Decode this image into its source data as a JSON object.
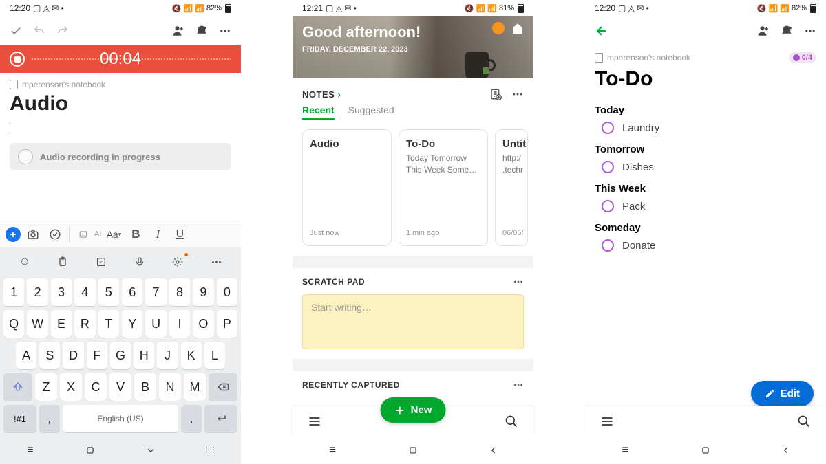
{
  "s1": {
    "status": {
      "time": "12:20",
      "battery": "82%"
    },
    "rec_time": "00:04",
    "notebook": "mperenson's notebook",
    "title": "Audio",
    "audio_msg": "Audio recording in progress",
    "format": {
      "ai": "AI",
      "aa": "Aa",
      "b": "B",
      "i": "I",
      "u": "U"
    },
    "kbd": {
      "r1": [
        "1",
        "2",
        "3",
        "4",
        "5",
        "6",
        "7",
        "8",
        "9",
        "0"
      ],
      "r2": [
        "Q",
        "W",
        "E",
        "R",
        "T",
        "Y",
        "U",
        "I",
        "O",
        "P"
      ],
      "r3": [
        "A",
        "S",
        "D",
        "F",
        "G",
        "H",
        "J",
        "K",
        "L"
      ],
      "r4": [
        "Z",
        "X",
        "C",
        "V",
        "B",
        "N",
        "M"
      ],
      "sym": "!#1",
      "comma": ",",
      "space": "English (US)",
      "dot": "."
    }
  },
  "s2": {
    "status": {
      "time": "12:21",
      "battery": "81%"
    },
    "hero": {
      "title": "Good afternoon!",
      "date": "FRIDAY, DECEMBER 22, 2023"
    },
    "notes_label": "NOTES",
    "tabs": {
      "recent": "Recent",
      "suggested": "Suggested"
    },
    "cards": [
      {
        "title": "Audio",
        "body": "",
        "time": "Just now"
      },
      {
        "title": "To-Do",
        "body": "Today Tomorrow This Week Some…",
        "time": "1 min ago"
      },
      {
        "title": "Untit",
        "body": "http:/\n.techr",
        "time": "06/05/"
      }
    ],
    "scratch_label": "SCRATCH PAD",
    "scratch_ph": "Start writing…",
    "captured_label": "RECENTLY CAPTURED",
    "fab": "New"
  },
  "s3": {
    "status": {
      "time": "12:20",
      "battery": "82%"
    },
    "notebook": "mperenson's notebook",
    "badge": "0/4",
    "title": "To-Do",
    "sections": [
      {
        "h": "Today",
        "items": [
          "Laundry"
        ]
      },
      {
        "h": "Tomorrow",
        "items": [
          "Dishes"
        ]
      },
      {
        "h": "This Week",
        "items": [
          "Pack"
        ]
      },
      {
        "h": "Someday",
        "items": [
          "Donate"
        ]
      }
    ],
    "fab": "Edit"
  }
}
